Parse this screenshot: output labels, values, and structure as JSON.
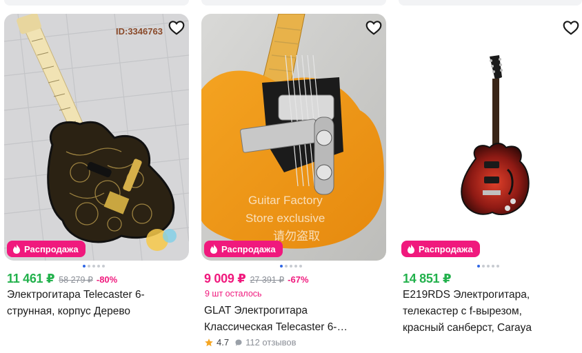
{
  "colors": {
    "price_green": "#22b14c",
    "price_red": "#f0197d",
    "badge_pink": "#f0197d",
    "dot_active": "#2f66e5"
  },
  "cards": [
    {
      "image_watermark": "ID:3346763",
      "favorite_icon": "heart-outline-icon",
      "badge": "Распродажа",
      "price": "11 461 ₽",
      "old_price": "58 279 ₽",
      "discount": "-80%",
      "title_line1": "Электрогитара Telecaster 6-",
      "title_line2": "струнная, корпус Дерево"
    },
    {
      "image_watermark_line1": "Guitar Factory",
      "image_watermark_line2": "Store exclusive",
      "image_watermark_line3": "请勿盗取",
      "favorite_icon": "heart-outline-icon",
      "badge": "Распродажа",
      "price": "9 009 ₽",
      "old_price": "27 391 ₽",
      "discount": "-67%",
      "stock": "9 шт осталось",
      "title_line1": "GLAT Электрогитара",
      "title_line2": "Классическая Telecaster 6-…",
      "rating": "4.7",
      "reviews": "112 отзывов"
    },
    {
      "favorite_icon": "heart-outline-icon",
      "badge": "Распродажа",
      "price": "14 851 ₽",
      "title_line1": "E219RDS Электрогитара,",
      "title_line2": "телекастер с f-вырезом,",
      "title_line3": "красный санберст, Caraya"
    }
  ]
}
